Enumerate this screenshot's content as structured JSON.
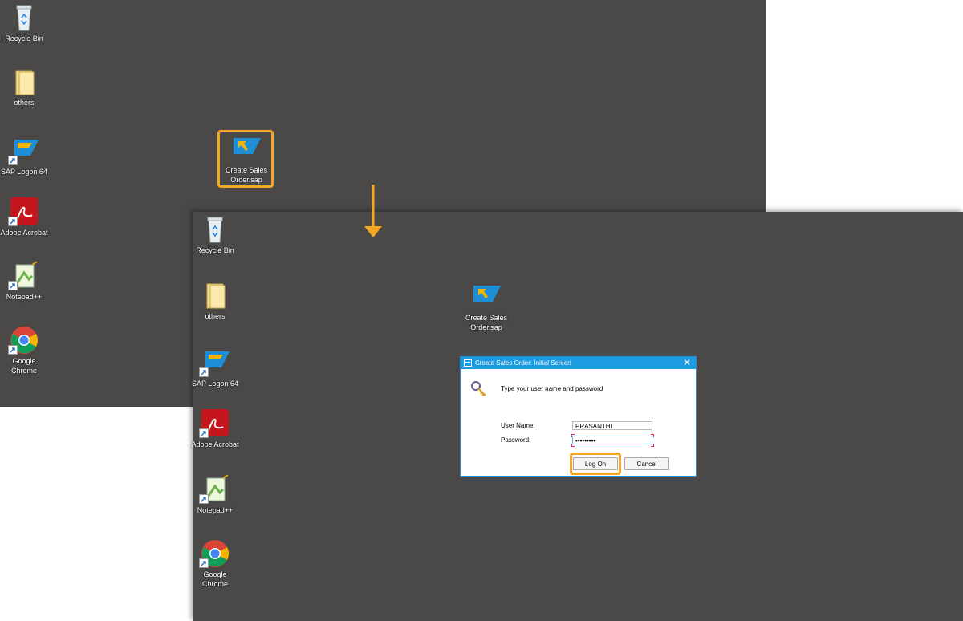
{
  "desktop_icons": {
    "recycle_bin": "Recycle Bin",
    "others": "others",
    "sap_logon": "SAP Logon 64",
    "adobe": "Adobe Acrobat",
    "notepad": "Notepad++",
    "chrome": "Google Chrome",
    "create_sales_order": "Create Sales Order.sap"
  },
  "dialog": {
    "title": "Create Sales Order: Initial Screen",
    "prompt": "Type your user name and password",
    "username_label": "User Name:",
    "username_value": "PRASANTHI",
    "password_label": "Password:",
    "password_value": "•••••••••",
    "logon_label": "Log On",
    "cancel_label": "Cancel"
  },
  "colors": {
    "desktop_bg": "#4a4948",
    "highlight": "#f5a623",
    "titlebar": "#1e9be0"
  }
}
